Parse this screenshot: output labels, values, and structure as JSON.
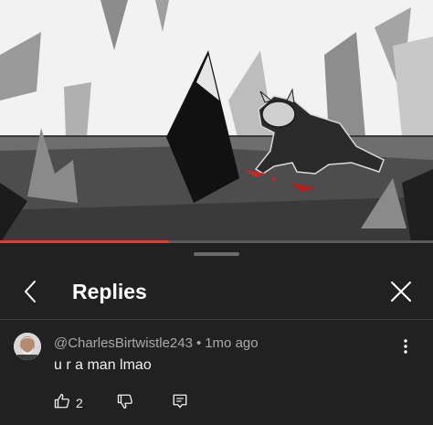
{
  "video": {
    "progress_fraction": 0.39,
    "progress_color": "#e53935"
  },
  "header": {
    "title": "Replies",
    "back_icon": "chevron-left-icon",
    "close_icon": "close-icon"
  },
  "comment": {
    "author": "@CharlesBirtwistle243",
    "separator": "•",
    "time": "1mo ago",
    "text": "u r a man lmao",
    "like_count": "2",
    "icons": {
      "like": "thumbs-up-icon",
      "dislike": "thumbs-down-icon",
      "reply": "reply-icon",
      "more": "more-vertical-icon"
    }
  }
}
